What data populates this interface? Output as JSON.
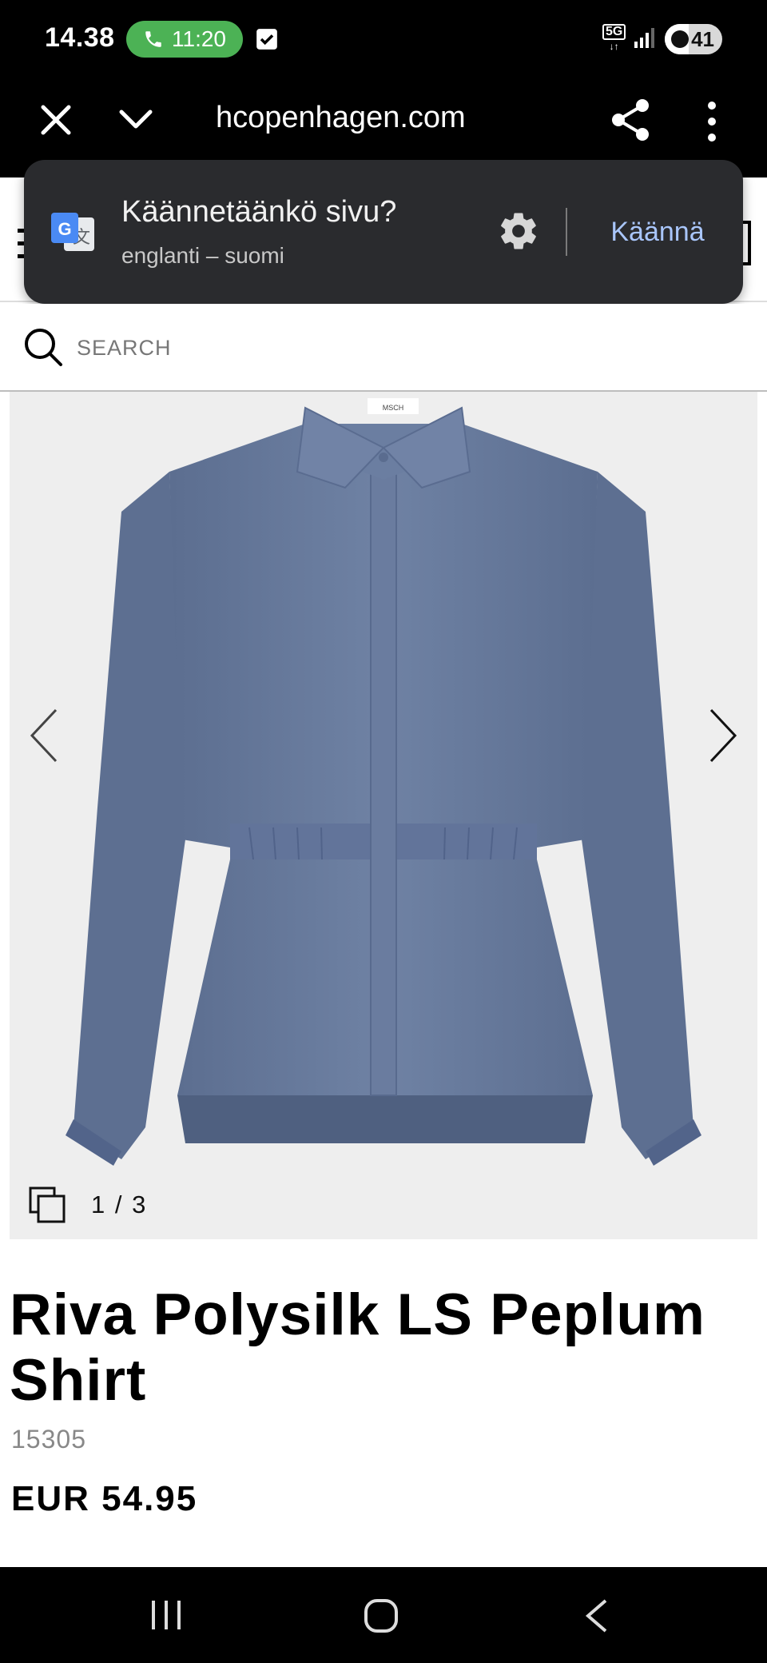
{
  "status_bar": {
    "time": "14.38",
    "call_duration": "11:20",
    "network": "5G",
    "battery": "41",
    "battery_level_percent": 41
  },
  "browser": {
    "url": "hcopenhagen.com"
  },
  "translate_popup": {
    "title": "Käännetäänkö sivu?",
    "languages": "englanti – suomi",
    "action": "Käännä"
  },
  "search": {
    "placeholder": "SEARCH"
  },
  "gallery": {
    "counter": "1 / 3",
    "brand_label": "MSCH"
  },
  "product": {
    "title": "Riva Polysilk LS Peplum Shirt",
    "sku": "15305",
    "price": "EUR 54.95",
    "color_hex": "#687a9c"
  }
}
